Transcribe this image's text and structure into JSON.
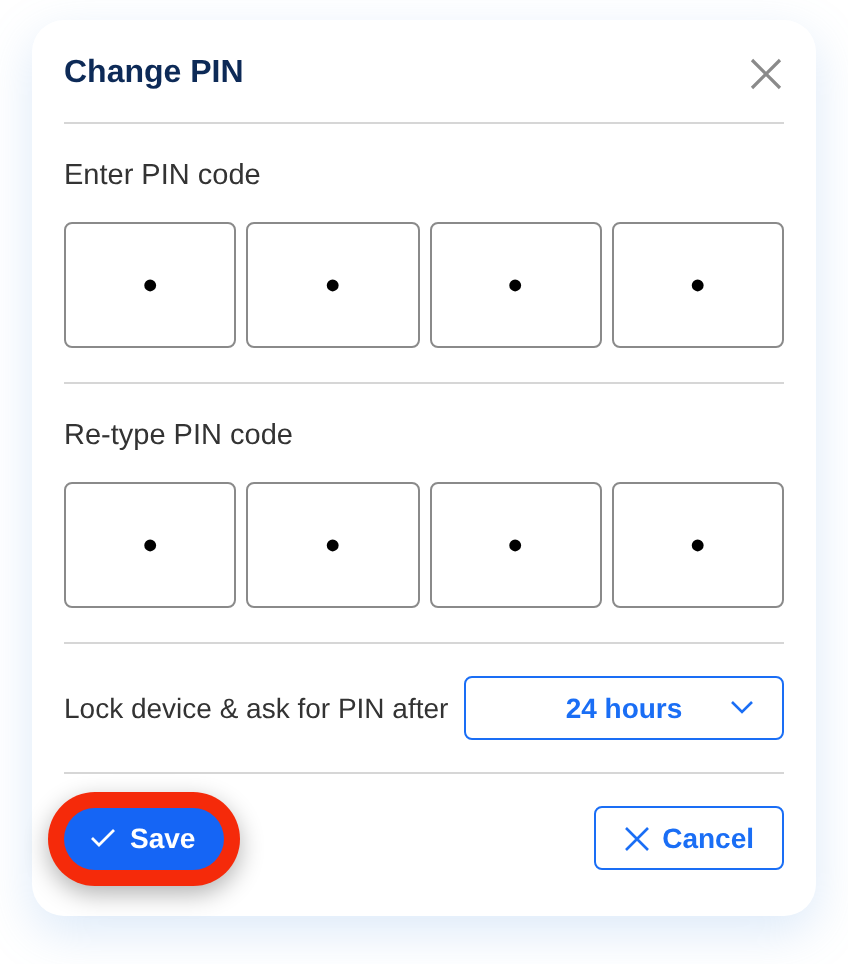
{
  "dialog": {
    "title": "Change PIN"
  },
  "pin_sections": [
    {
      "label": "Enter PIN code",
      "digits": [
        "•",
        "•",
        "•",
        "•"
      ]
    },
    {
      "label": "Re-type PIN code",
      "digits": [
        "•",
        "•",
        "•",
        "•"
      ]
    }
  ],
  "lock": {
    "label": "Lock device & ask for PIN after",
    "value": "24 hours"
  },
  "buttons": [
    {
      "kind": "primary",
      "label": "Save",
      "highlighted": true
    },
    {
      "kind": "outline",
      "label": "Cancel",
      "highlighted": false
    }
  ]
}
